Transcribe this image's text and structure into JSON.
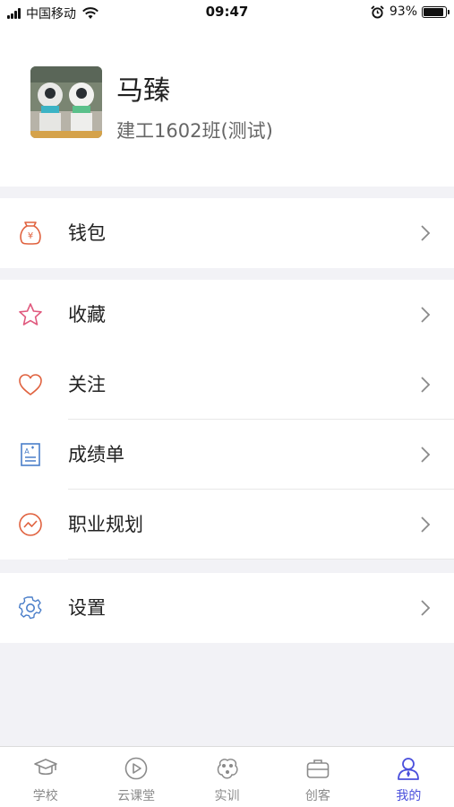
{
  "status_bar": {
    "carrier": "中国移动",
    "time": "09:47",
    "battery": "93%",
    "battery_level": 0.93
  },
  "profile": {
    "name": "马臻",
    "class_name": "建工1602班(测试)"
  },
  "menu": {
    "wallet": "钱包",
    "favorites": "收藏",
    "follow": "关注",
    "transcript": "成绩单",
    "career": "职业规划",
    "settings": "设置"
  },
  "tabs": [
    {
      "label": "学校",
      "icon": "graduation-cap-icon"
    },
    {
      "label": "云课堂",
      "icon": "play-circle-icon"
    },
    {
      "label": "实训",
      "icon": "network-icon"
    },
    {
      "label": "创客",
      "icon": "briefcase-icon"
    },
    {
      "label": "我的",
      "icon": "user-icon",
      "active": true
    }
  ],
  "colors": {
    "accent": "#4a4fdc",
    "icon_red": "#e0623f",
    "icon_pink": "#e05a7e",
    "icon_blue": "#4a7ec9",
    "background": "#f2f2f6"
  }
}
